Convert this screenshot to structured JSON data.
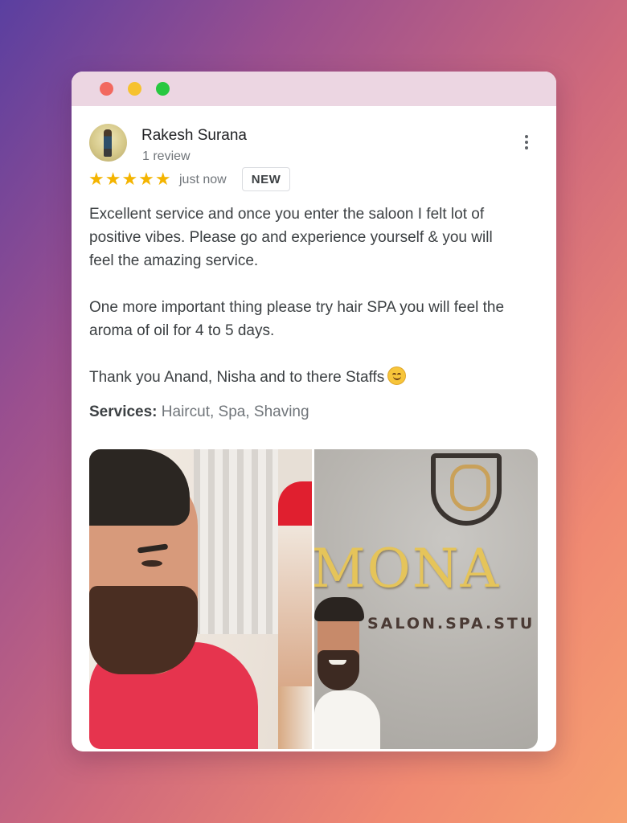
{
  "window": {
    "controls": [
      "close",
      "minimize",
      "zoom"
    ]
  },
  "review": {
    "reviewer_name": "Rakesh Surana",
    "review_count": "1 review",
    "rating": 5,
    "stars": "★★★★★",
    "timestamp": "just now",
    "badge": "NEW",
    "paragraphs": [
      "Excellent service and once you enter the saloon I felt lot of positive vibes. Please go and experience yourself & you will feel the amazing service.",
      "One more important thing please try hair SPA you will feel the aroma of oil for 4 to 5 days.",
      "Thank you Anand, Nisha and to there Staffs"
    ],
    "emoji": "smiling-face-emoji",
    "services_label": "Services:",
    "services_value": "Haircut, Spa, Shaving"
  },
  "photos": {
    "photo_2_brand": "MONA",
    "photo_2_subtitle": "SALON.SPA.STU"
  },
  "icons": {
    "more_menu": "more-vert-icon"
  },
  "colors": {
    "star": "#f4b400",
    "window_titlebar": "#ecd6e2",
    "close": "#f2695f",
    "minimize": "#f6c22f",
    "zoom": "#27c840"
  }
}
